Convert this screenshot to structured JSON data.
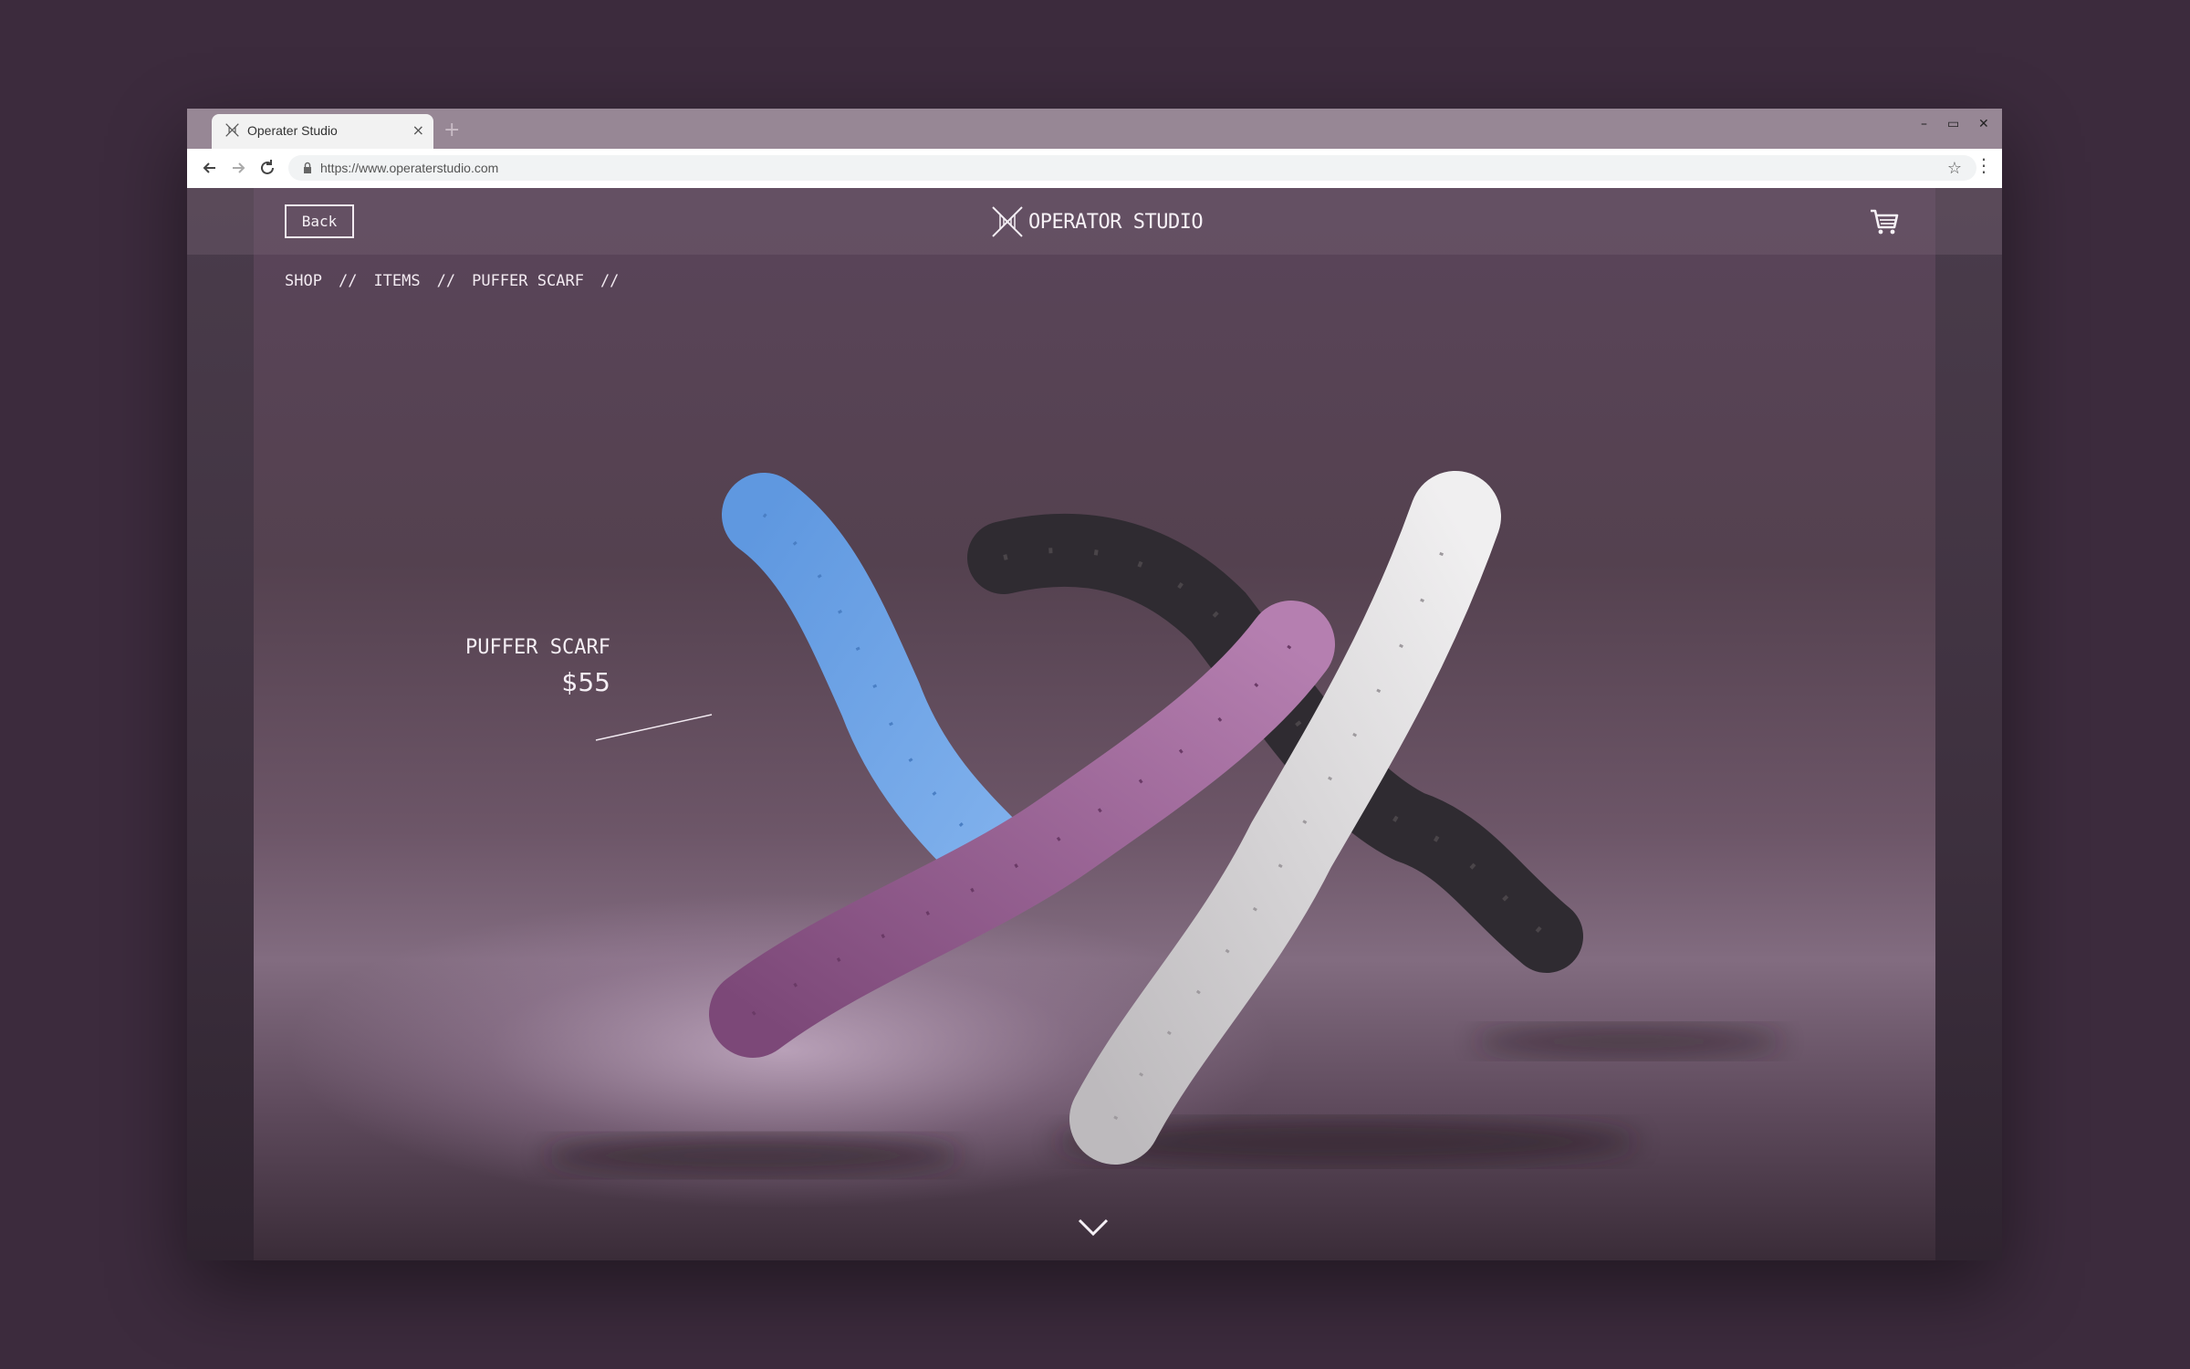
{
  "browser": {
    "tab_title": "Operater Studio",
    "tab_close": "×",
    "new_tab": "+",
    "url": "https://www.operaterstudio.com",
    "win_minimize": "–",
    "win_maximize": "▭",
    "win_close": "✕",
    "star": "☆",
    "menu": "⋮"
  },
  "header": {
    "back_label": "Back",
    "brand_name": "OPERATOR STUDIO",
    "cart_icon": "cart-icon"
  },
  "breadcrumb": {
    "items": [
      "SHOP",
      "ITEMS",
      "PUFFER SCARF"
    ],
    "separator": "//"
  },
  "product": {
    "name": "PUFFER SCARF",
    "price": "$55"
  },
  "colors": {
    "background": "#3c2b3d",
    "scarf_blue": "#6aa0e0",
    "scarf_purple": "#9a6095",
    "scarf_black": "#2e2b30",
    "scarf_white": "#d8d6d8"
  }
}
